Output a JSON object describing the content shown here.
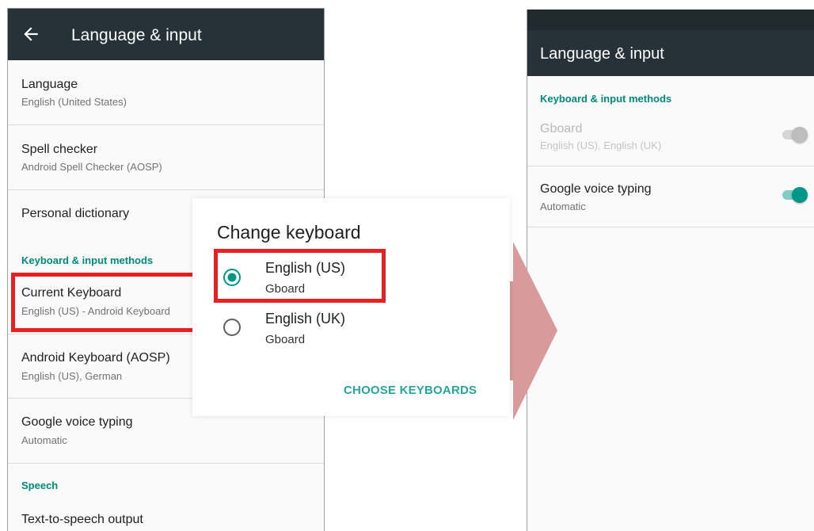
{
  "left_screen": {
    "title": "Language & input",
    "items": [
      {
        "title": "Language",
        "summary": "English (United States)"
      },
      {
        "title": "Spell checker",
        "summary": "Android Spell Checker (AOSP)"
      },
      {
        "title": "Personal dictionary",
        "summary": ""
      }
    ],
    "category_keyboard": "Keyboard & input methods",
    "keyboard_items": [
      {
        "title": "Current Keyboard",
        "summary": "English (US) - Android Keyboard"
      },
      {
        "title": "Android Keyboard (AOSP)",
        "summary": "English (US), German"
      },
      {
        "title": "Google voice typing",
        "summary": "Automatic"
      }
    ],
    "category_speech": "Speech",
    "speech_items": [
      {
        "title": "Text-to-speech output"
      }
    ]
  },
  "dialog": {
    "title": "Change keyboard",
    "options": [
      {
        "title": "English (US)",
        "subtitle": "Gboard",
        "selected": true
      },
      {
        "title": "English (UK)",
        "subtitle": "Gboard",
        "selected": false
      }
    ],
    "action": "CHOOSE KEYBOARDS"
  },
  "right_screen": {
    "title": "Language & input",
    "category": "Keyboard & input methods",
    "items": [
      {
        "title": "Gboard",
        "summary": "English (US), English (UK)",
        "enabled": false,
        "toggle_on": true
      },
      {
        "title": "Google voice typing",
        "summary": "Automatic",
        "enabled": true,
        "toggle_on": true
      }
    ]
  },
  "colors": {
    "app_bar": "#263238",
    "accent": "#009688",
    "highlight": "#e8201f",
    "arrow": "#d89a9a"
  }
}
